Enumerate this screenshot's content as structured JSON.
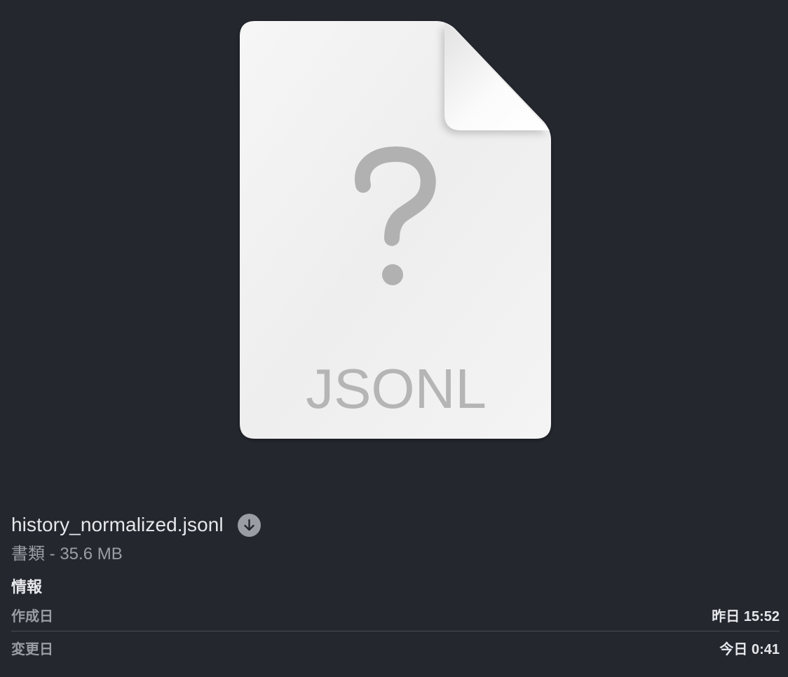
{
  "preview": {
    "icon": "document-unknown-icon",
    "type_label": "JSONL",
    "glyph": "?"
  },
  "file": {
    "name": "history_normalized.jsonl",
    "kind_size": "書類 - 35.6 MB",
    "download_icon": "download-icon"
  },
  "info": {
    "title": "情報",
    "rows": [
      {
        "label": "作成日",
        "value": "昨日 15:52"
      },
      {
        "label": "変更日",
        "value": "今日 0:41"
      }
    ]
  },
  "colors": {
    "background": "#24272e",
    "page": "#f2f2f2",
    "glyph": "#b3b3b3"
  }
}
